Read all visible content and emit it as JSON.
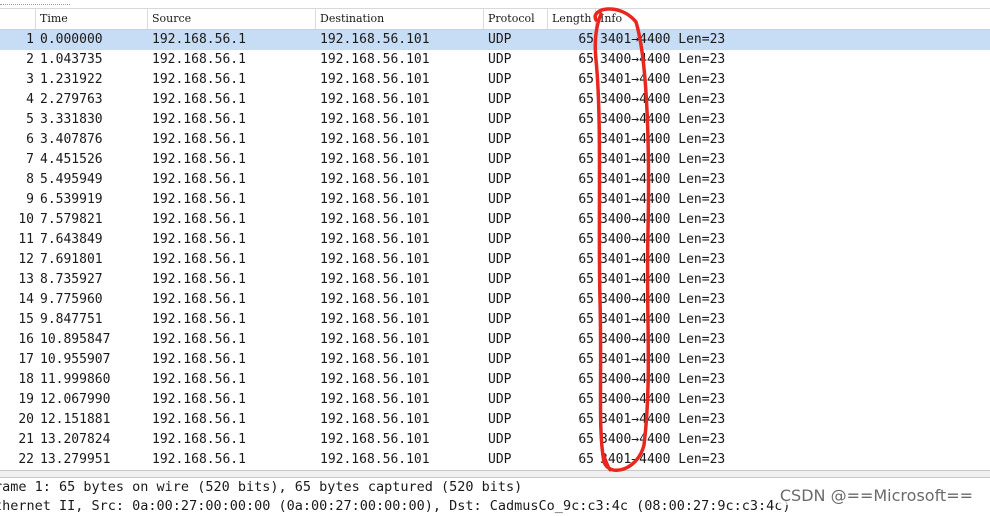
{
  "columns": {
    "time": "Time",
    "source": "Source",
    "destination": "Destination",
    "protocol": "Protocol",
    "length": "Length",
    "info": "Info"
  },
  "packets": [
    {
      "no": "1",
      "time": "0.000000",
      "source": "192.168.56.1",
      "destination": "192.168.56.101",
      "protocol": "UDP",
      "length": "65",
      "info": "3401→4400  Len=23"
    },
    {
      "no": "2",
      "time": "1.043735",
      "source": "192.168.56.1",
      "destination": "192.168.56.101",
      "protocol": "UDP",
      "length": "65",
      "info": "3400→4400  Len=23"
    },
    {
      "no": "3",
      "time": "1.231922",
      "source": "192.168.56.1",
      "destination": "192.168.56.101",
      "protocol": "UDP",
      "length": "65",
      "info": "3401→4400  Len=23"
    },
    {
      "no": "4",
      "time": "2.279763",
      "source": "192.168.56.1",
      "destination": "192.168.56.101",
      "protocol": "UDP",
      "length": "65",
      "info": "3400→4400  Len=23"
    },
    {
      "no": "5",
      "time": "3.331830",
      "source": "192.168.56.1",
      "destination": "192.168.56.101",
      "protocol": "UDP",
      "length": "65",
      "info": "3400→4400  Len=23"
    },
    {
      "no": "6",
      "time": "3.407876",
      "source": "192.168.56.1",
      "destination": "192.168.56.101",
      "protocol": "UDP",
      "length": "65",
      "info": "3401→4400  Len=23"
    },
    {
      "no": "7",
      "time": "4.451526",
      "source": "192.168.56.1",
      "destination": "192.168.56.101",
      "protocol": "UDP",
      "length": "65",
      "info": "3401→4400  Len=23"
    },
    {
      "no": "8",
      "time": "5.495949",
      "source": "192.168.56.1",
      "destination": "192.168.56.101",
      "protocol": "UDP",
      "length": "65",
      "info": "3401→4400  Len=23"
    },
    {
      "no": "9",
      "time": "6.539919",
      "source": "192.168.56.1",
      "destination": "192.168.56.101",
      "protocol": "UDP",
      "length": "65",
      "info": "3401→4400  Len=23"
    },
    {
      "no": "10",
      "time": "7.579821",
      "source": "192.168.56.1",
      "destination": "192.168.56.101",
      "protocol": "UDP",
      "length": "65",
      "info": "3400→4400  Len=23"
    },
    {
      "no": "11",
      "time": "7.643849",
      "source": "192.168.56.1",
      "destination": "192.168.56.101",
      "protocol": "UDP",
      "length": "65",
      "info": "3400→4400  Len=23"
    },
    {
      "no": "12",
      "time": "7.691801",
      "source": "192.168.56.1",
      "destination": "192.168.56.101",
      "protocol": "UDP",
      "length": "65",
      "info": "3401→4400  Len=23"
    },
    {
      "no": "13",
      "time": "8.735927",
      "source": "192.168.56.1",
      "destination": "192.168.56.101",
      "protocol": "UDP",
      "length": "65",
      "info": "3401→4400  Len=23"
    },
    {
      "no": "14",
      "time": "9.775960",
      "source": "192.168.56.1",
      "destination": "192.168.56.101",
      "protocol": "UDP",
      "length": "65",
      "info": "3400→4400  Len=23"
    },
    {
      "no": "15",
      "time": "9.847751",
      "source": "192.168.56.1",
      "destination": "192.168.56.101",
      "protocol": "UDP",
      "length": "65",
      "info": "3401→4400  Len=23"
    },
    {
      "no": "16",
      "time": "10.895847",
      "source": "192.168.56.1",
      "destination": "192.168.56.101",
      "protocol": "UDP",
      "length": "65",
      "info": "3400→4400  Len=23"
    },
    {
      "no": "17",
      "time": "10.955907",
      "source": "192.168.56.1",
      "destination": "192.168.56.101",
      "protocol": "UDP",
      "length": "65",
      "info": "3401→4400  Len=23"
    },
    {
      "no": "18",
      "time": "11.999860",
      "source": "192.168.56.1",
      "destination": "192.168.56.101",
      "protocol": "UDP",
      "length": "65",
      "info": "3400→4400  Len=23"
    },
    {
      "no": "19",
      "time": "12.067990",
      "source": "192.168.56.1",
      "destination": "192.168.56.101",
      "protocol": "UDP",
      "length": "65",
      "info": "3400→4400  Len=23"
    },
    {
      "no": "20",
      "time": "12.151881",
      "source": "192.168.56.1",
      "destination": "192.168.56.101",
      "protocol": "UDP",
      "length": "65",
      "info": "3401→4400  Len=23"
    },
    {
      "no": "21",
      "time": "13.207824",
      "source": "192.168.56.1",
      "destination": "192.168.56.101",
      "protocol": "UDP",
      "length": "65",
      "info": "3400→4400  Len=23"
    },
    {
      "no": "22",
      "time": "13.279951",
      "source": "192.168.56.1",
      "destination": "192.168.56.101",
      "protocol": "UDP",
      "length": "65",
      "info": "3401→4400  Len=23"
    }
  ],
  "selected_row": 0,
  "details": [
    "rame 1: 65 bytes on wire (520 bits), 65 bytes captured (520 bits)",
    "thernet II, Src: 0a:00:27:00:00:00 (0a:00:27:00:00:00), Dst: CadmusCo_9c:c3:4c (08:00:27:9c:c3:4c)"
  ],
  "watermark": "CSDN @==Microsoft==",
  "colors": {
    "selected_row": "#c7dcf5",
    "annotation": "#e8271f"
  }
}
